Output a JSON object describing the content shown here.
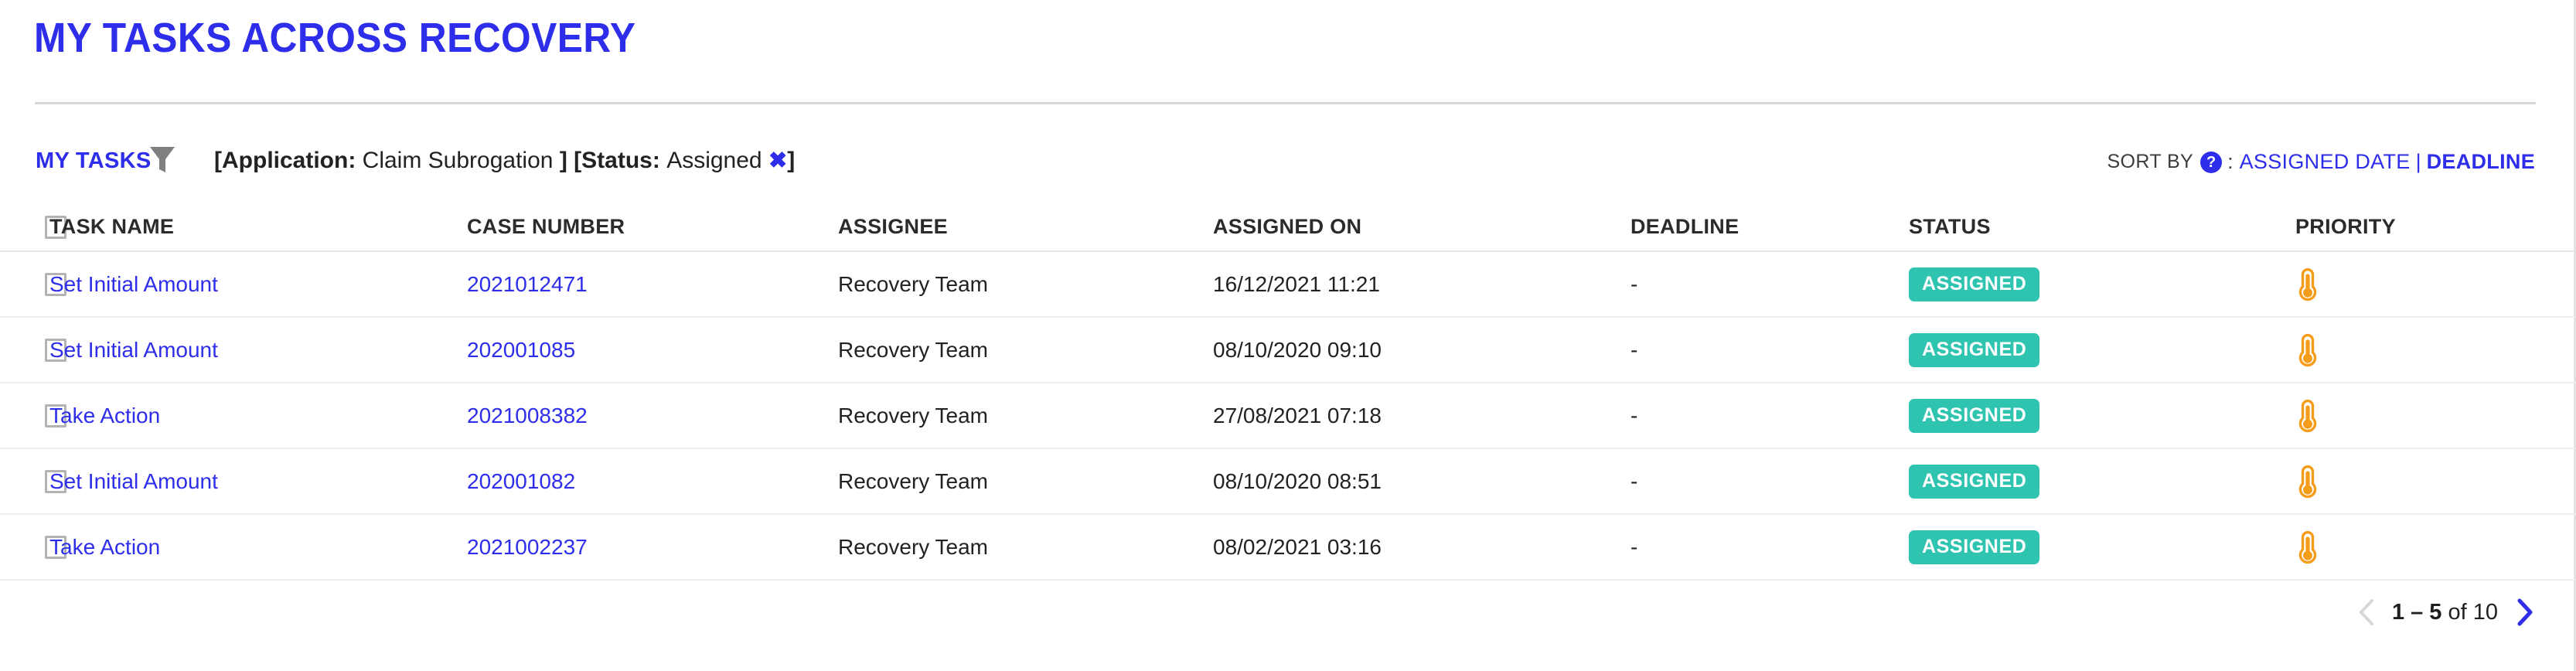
{
  "header": {
    "title": "MY TASKS ACROSS RECOVERY"
  },
  "filter_bar": {
    "list_label": "MY TASKS",
    "funnel_icon": "filter-funnel-icon",
    "chips": [
      {
        "open_bracket": "[",
        "label": "Application:",
        "value": "Claim Subrogation",
        "close_bracket": "]",
        "removable": false
      },
      {
        "open_bracket": "[",
        "label": "Status:",
        "value": "Assigned",
        "remove_glyph": "✖",
        "close_bracket": "]",
        "removable": true
      }
    ]
  },
  "sort": {
    "label": "SORT BY",
    "help_icon": "question-mark-help-icon",
    "colon": ":",
    "options": [
      {
        "label": "ASSIGNED DATE",
        "active": false
      },
      {
        "label": "DEADLINE",
        "active": true
      }
    ],
    "separator": "|"
  },
  "table": {
    "columns": [
      "TASK NAME",
      "CASE NUMBER",
      "ASSIGNEE",
      "ASSIGNED ON",
      "DEADLINE",
      "STATUS",
      "PRIORITY"
    ],
    "rows": [
      {
        "task_name": "Set Initial Amount",
        "case_number": "2021012471",
        "assignee": "Recovery Team",
        "assigned_on": "16/12/2021 11:21",
        "deadline": "-",
        "status": "ASSIGNED",
        "priority_icon": "thermometer-icon"
      },
      {
        "task_name": "Set Initial Amount",
        "case_number": "202001085",
        "assignee": "Recovery Team",
        "assigned_on": "08/10/2020 09:10",
        "deadline": "-",
        "status": "ASSIGNED",
        "priority_icon": "thermometer-icon"
      },
      {
        "task_name": "Take Action",
        "case_number": "2021008382",
        "assignee": "Recovery Team",
        "assigned_on": "27/08/2021 07:18",
        "deadline": "-",
        "status": "ASSIGNED",
        "priority_icon": "thermometer-icon"
      },
      {
        "task_name": "Set Initial Amount",
        "case_number": "202001082",
        "assignee": "Recovery Team",
        "assigned_on": "08/10/2020 08:51",
        "deadline": "-",
        "status": "ASSIGNED",
        "priority_icon": "thermometer-icon"
      },
      {
        "task_name": "Take Action",
        "case_number": "2021002237",
        "assignee": "Recovery Team",
        "assigned_on": "08/02/2021 03:16",
        "deadline": "-",
        "status": "ASSIGNED",
        "priority_icon": "thermometer-icon"
      }
    ]
  },
  "pagination": {
    "range": "1 – 5",
    "of_text": " of 10",
    "prev_enabled": false,
    "next_enabled": true,
    "prev_icon": "chevron-left-icon",
    "next_icon": "chevron-right-icon"
  },
  "colors": {
    "brand_blue": "#2d2dea",
    "status_teal": "#2ec4b0",
    "priority_orange": "#f59c1a",
    "disabled_gray": "#d8d8d8",
    "funnel_gray": "#808080"
  }
}
